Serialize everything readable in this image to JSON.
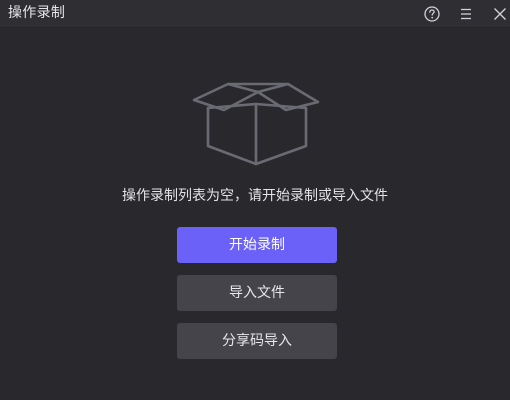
{
  "window": {
    "title": "操作录制"
  },
  "titlebar_icons": {
    "help": "help-icon",
    "menu": "menu-icon",
    "close": "close-icon"
  },
  "empty_state": {
    "icon": "empty-box-icon",
    "message": "操作录制列表为空，请开始录制或导入文件"
  },
  "actions": {
    "start_recording": "开始录制",
    "import_file": "导入文件",
    "share_code_import": "分享码导入"
  },
  "colors": {
    "background": "#28282d",
    "titlebar": "#2e2e33",
    "primary": "#6b61f8",
    "secondary": "#44444a",
    "text": "#e4e4e8"
  }
}
